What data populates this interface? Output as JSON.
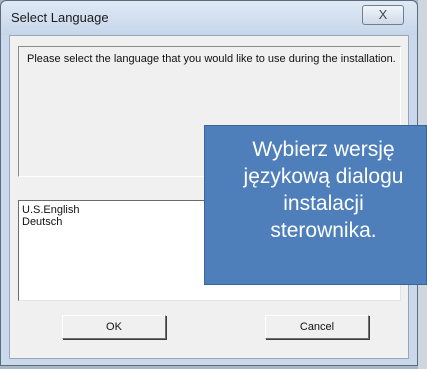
{
  "dialog": {
    "title": "Select Language",
    "close_label": "X",
    "prompt": "Please select the language that you would like to use during the installation.",
    "languages": [
      "U.S.English",
      "Deutsch"
    ],
    "ok_label": "OK",
    "cancel_label": "Cancel"
  },
  "overlay": {
    "lines": [
      "Wybierz wersję",
      "językową dialogu",
      "instalacji",
      "sterownika."
    ]
  }
}
